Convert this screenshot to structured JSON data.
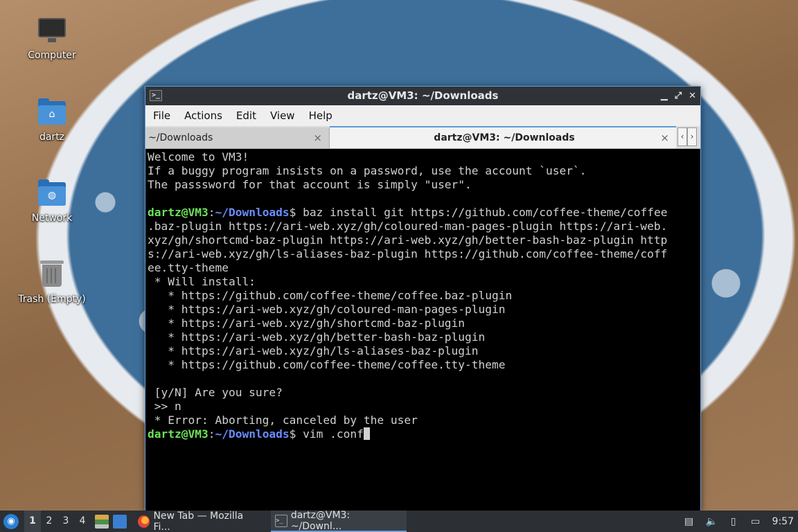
{
  "desktop": {
    "icons": [
      {
        "label": "Computer",
        "icon": "computer-icon"
      },
      {
        "label": "dartz",
        "icon": "home-folder-icon"
      },
      {
        "label": "Network",
        "icon": "network-folder-icon"
      },
      {
        "label": "Trash (Empty)",
        "icon": "trash-icon"
      }
    ]
  },
  "window": {
    "title": "dartz@VM3: ~/Downloads",
    "controls": {
      "minimize": "▁",
      "maximize": "⤢",
      "close": "✕"
    },
    "menu": [
      "File",
      "Actions",
      "Edit",
      "View",
      "Help"
    ],
    "tabs": [
      {
        "label": "~/Downloads",
        "active": false
      },
      {
        "label": "dartz@VM3: ~/Downloads",
        "active": true
      }
    ],
    "tab_close": "×",
    "tab_scroll": {
      "left": "‹",
      "right": "›"
    }
  },
  "terminal": {
    "motd": [
      "Welcome to VM3!",
      "If a buggy program insists on a password, use the account `user`.",
      "The passsword for that account is simply \"user\".",
      ""
    ],
    "prompt": {
      "user": "dartz@VM3",
      "colon": ":",
      "path": "~/Downloads",
      "sign": "$"
    },
    "command1": " baz install git https://github.com/coffee-theme/coffee",
    "wrapped": [
      ".baz-plugin https://ari-web.xyz/gh/coloured-man-pages-plugin https://ari-web.",
      "xyz/gh/shortcmd-baz-plugin https://ari-web.xyz/gh/better-bash-baz-plugin http",
      "s://ari-web.xyz/gh/ls-aliases-baz-plugin https://github.com/coffee-theme/coff",
      "ee.tty-theme"
    ],
    "output": [
      " * Will install:",
      "   * https://github.com/coffee-theme/coffee.baz-plugin",
      "   * https://ari-web.xyz/gh/coloured-man-pages-plugin",
      "   * https://ari-web.xyz/gh/shortcmd-baz-plugin",
      "   * https://ari-web.xyz/gh/better-bash-baz-plugin",
      "   * https://ari-web.xyz/gh/ls-aliases-baz-plugin",
      "   * https://github.com/coffee-theme/coffee.tty-theme",
      "",
      " [y/N] Are you sure?",
      " >> n",
      " * Error: Aborting, canceled by the user"
    ],
    "command2": " vim .conf"
  },
  "taskbar": {
    "workspaces": [
      "1",
      "2",
      "3",
      "4"
    ],
    "current_workspace": "1",
    "tasks": [
      {
        "label": "New Tab — Mozilla Fi...",
        "icon": "firefox-icon"
      },
      {
        "label": "dartz@VM3: ~/Downl...",
        "icon": "terminal-icon"
      }
    ],
    "tray": [
      "clipboard-icon",
      "volume-icon",
      "notes-icon",
      "network-icon"
    ],
    "clock": "9:57"
  }
}
